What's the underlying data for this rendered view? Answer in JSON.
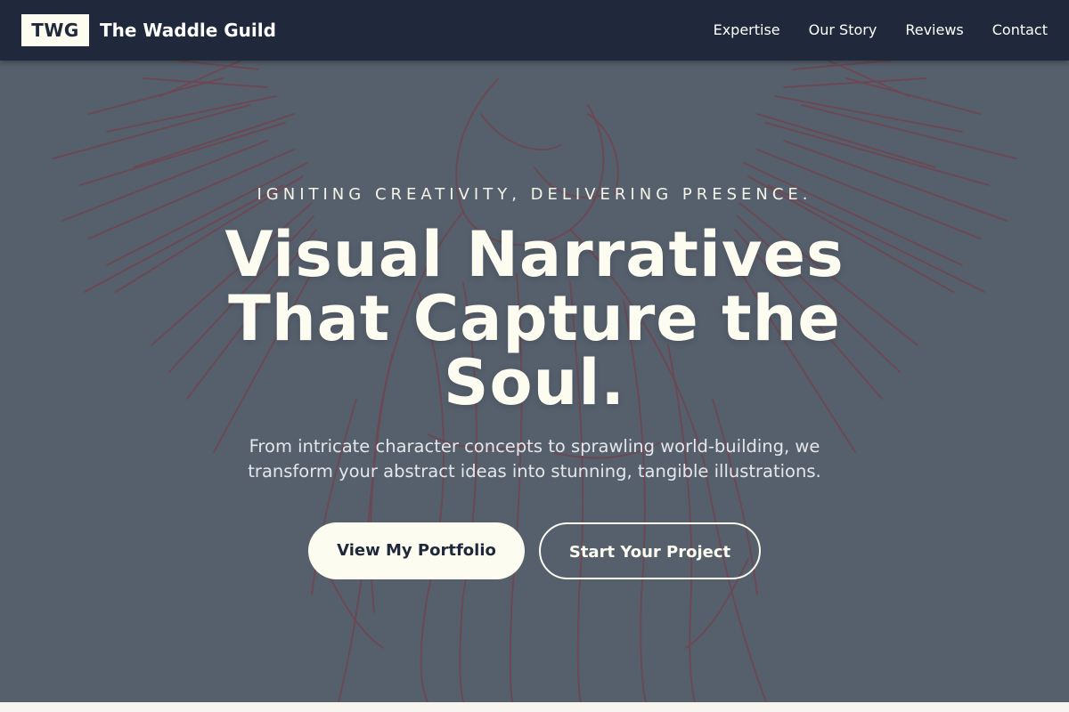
{
  "nav": {
    "logo": "TWG",
    "brand": "The Waddle Guild",
    "links": [
      "Expertise",
      "Our Story",
      "Reviews",
      "Contact"
    ]
  },
  "hero": {
    "background_image": "engraving-angel-illustration",
    "tagline": "IGNITING CREATIVITY, DELIVERING PRESENCE.",
    "headline": "Visual Narratives That Capture the Soul.",
    "subtitle": "From intricate character concepts to sprawling world-building, we transform your abstract ideas into stunning, tangible illustrations.",
    "primary_button": "View My Portfolio",
    "secondary_button": "Start Your Project"
  },
  "colors": {
    "navbar": "#1f293b",
    "cream": "#fdfcf0",
    "hero_overlay": "#56606e",
    "illustration": "#7a3a44"
  }
}
